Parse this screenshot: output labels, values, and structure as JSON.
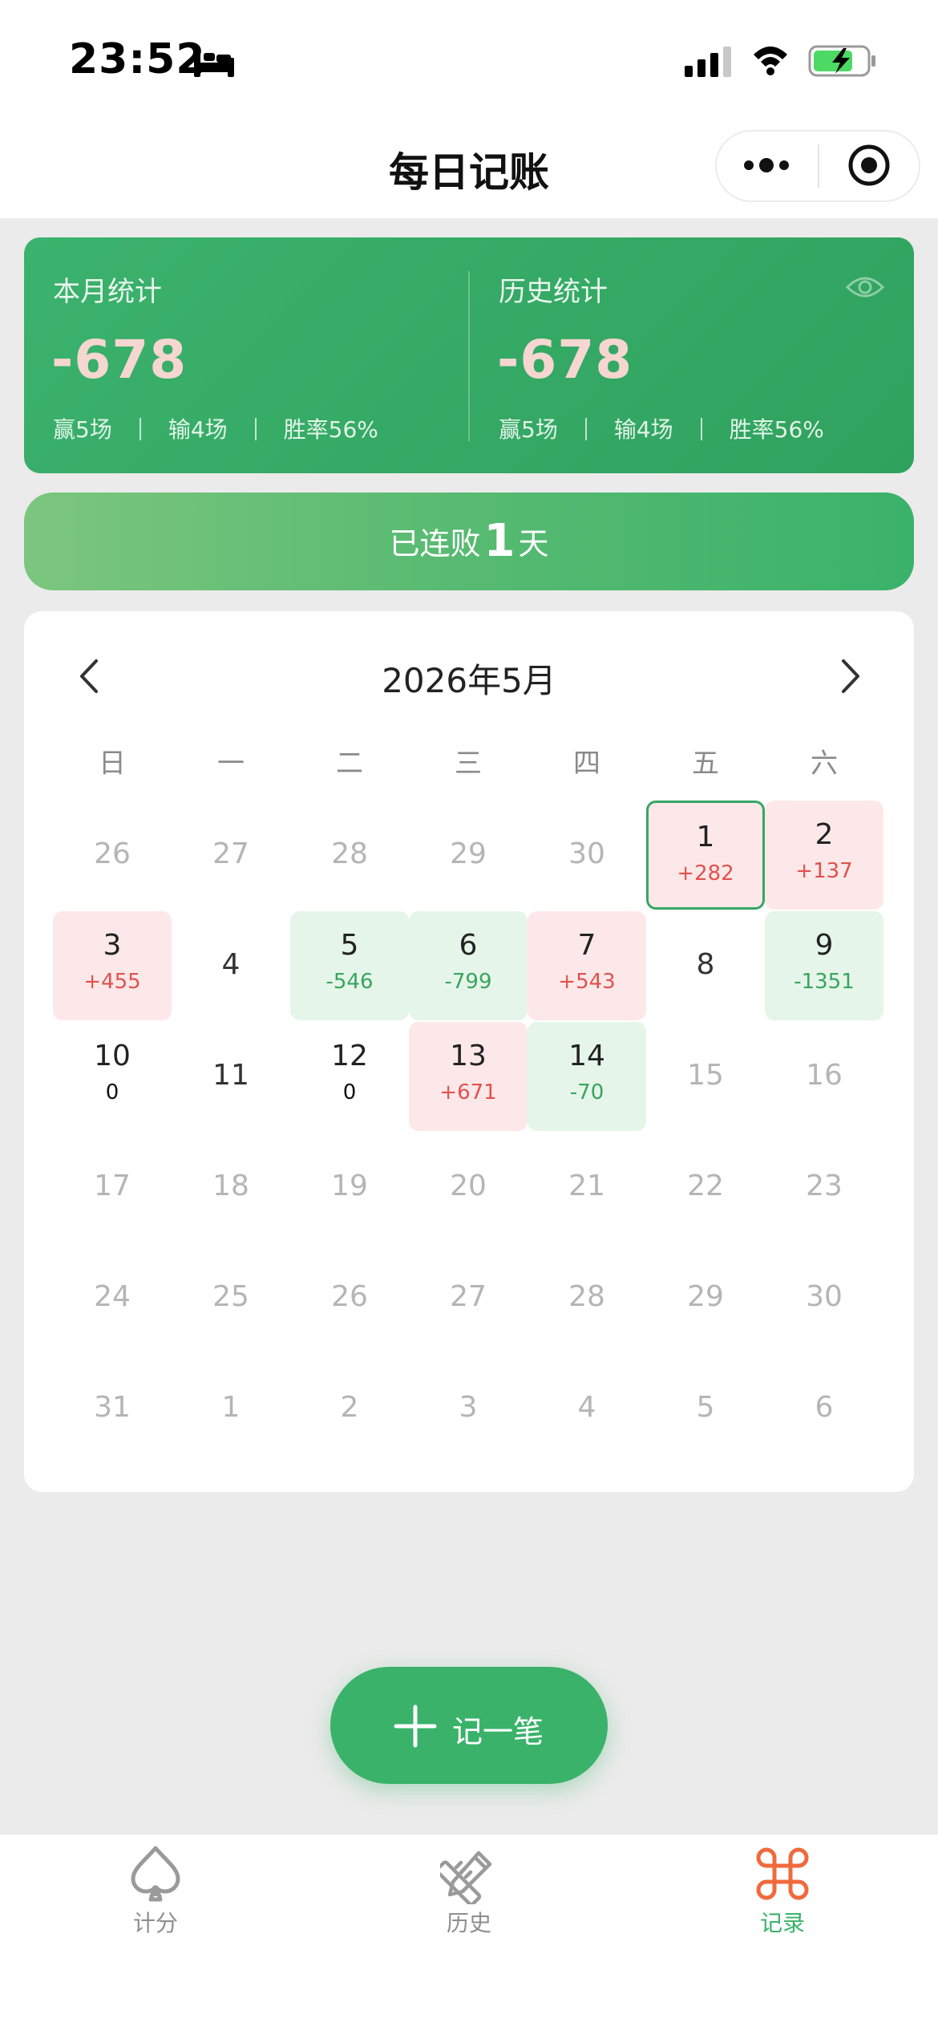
{
  "status": {
    "time": "23:52"
  },
  "nav": {
    "title": "每日记账"
  },
  "stats": {
    "month": {
      "label": "本月统计",
      "value": "-678",
      "wins": "赢5场",
      "losses": "输4场",
      "rate": "胜率56%"
    },
    "history": {
      "label": "历史统计",
      "value": "-678",
      "wins": "赢5场",
      "losses": "输4场",
      "rate": "胜率56%"
    }
  },
  "streak": {
    "prefix": "已连败",
    "count": "1",
    "suffix": "天"
  },
  "calendar": {
    "title": "2026年5月",
    "weekdays": [
      "日",
      "一",
      "二",
      "三",
      "四",
      "五",
      "六"
    ],
    "days": [
      {
        "n": "26",
        "amt": "",
        "state": "other"
      },
      {
        "n": "27",
        "amt": "",
        "state": "other"
      },
      {
        "n": "28",
        "amt": "",
        "state": "other"
      },
      {
        "n": "29",
        "amt": "",
        "state": "other"
      },
      {
        "n": "30",
        "amt": "",
        "state": "other"
      },
      {
        "n": "1",
        "amt": "+282",
        "state": "win today"
      },
      {
        "n": "2",
        "amt": "+137",
        "state": "win"
      },
      {
        "n": "3",
        "amt": "+455",
        "state": "win"
      },
      {
        "n": "4",
        "amt": "",
        "state": "plain"
      },
      {
        "n": "5",
        "amt": "-546",
        "state": "loss"
      },
      {
        "n": "6",
        "amt": "-799",
        "state": "loss"
      },
      {
        "n": "7",
        "amt": "+543",
        "state": "win"
      },
      {
        "n": "8",
        "amt": "",
        "state": "plain"
      },
      {
        "n": "9",
        "amt": "-1351",
        "state": "loss"
      },
      {
        "n": "10",
        "amt": "0",
        "state": "zero"
      },
      {
        "n": "11",
        "amt": "",
        "state": "plain"
      },
      {
        "n": "12",
        "amt": "0",
        "state": "zero"
      },
      {
        "n": "13",
        "amt": "+671",
        "state": "win"
      },
      {
        "n": "14",
        "amt": "-70",
        "state": "loss"
      },
      {
        "n": "15",
        "amt": "",
        "state": "other"
      },
      {
        "n": "16",
        "amt": "",
        "state": "other"
      },
      {
        "n": "17",
        "amt": "",
        "state": "other"
      },
      {
        "n": "18",
        "amt": "",
        "state": "other"
      },
      {
        "n": "19",
        "amt": "",
        "state": "other"
      },
      {
        "n": "20",
        "amt": "",
        "state": "other"
      },
      {
        "n": "21",
        "amt": "",
        "state": "other"
      },
      {
        "n": "22",
        "amt": "",
        "state": "other"
      },
      {
        "n": "23",
        "amt": "",
        "state": "other"
      },
      {
        "n": "24",
        "amt": "",
        "state": "other"
      },
      {
        "n": "25",
        "amt": "",
        "state": "other"
      },
      {
        "n": "26",
        "amt": "",
        "state": "other"
      },
      {
        "n": "27",
        "amt": "",
        "state": "other"
      },
      {
        "n": "28",
        "amt": "",
        "state": "other"
      },
      {
        "n": "29",
        "amt": "",
        "state": "other"
      },
      {
        "n": "30",
        "amt": "",
        "state": "other"
      },
      {
        "n": "31",
        "amt": "",
        "state": "other"
      },
      {
        "n": "1",
        "amt": "",
        "state": "other"
      },
      {
        "n": "2",
        "amt": "",
        "state": "other"
      },
      {
        "n": "3",
        "amt": "",
        "state": "other"
      },
      {
        "n": "4",
        "amt": "",
        "state": "other"
      },
      {
        "n": "5",
        "amt": "",
        "state": "other"
      },
      {
        "n": "6",
        "amt": "",
        "state": "other"
      }
    ]
  },
  "fab": {
    "label": "记一笔"
  },
  "tabs": [
    {
      "label": "计分",
      "icon": "spade-icon",
      "active": false
    },
    {
      "label": "历史",
      "icon": "pencil-ruler-icon",
      "active": false
    },
    {
      "label": "记录",
      "icon": "command-icon",
      "active": true
    }
  ],
  "colors": {
    "primary": "#3ab26a",
    "win_bg": "#fde8e9",
    "win_text": "#e1514e",
    "loss_bg": "#e6f5e9",
    "loss_text": "#38a55f",
    "tab_active": "#3ab26a",
    "tab_active_icon": "#f06a3d"
  }
}
